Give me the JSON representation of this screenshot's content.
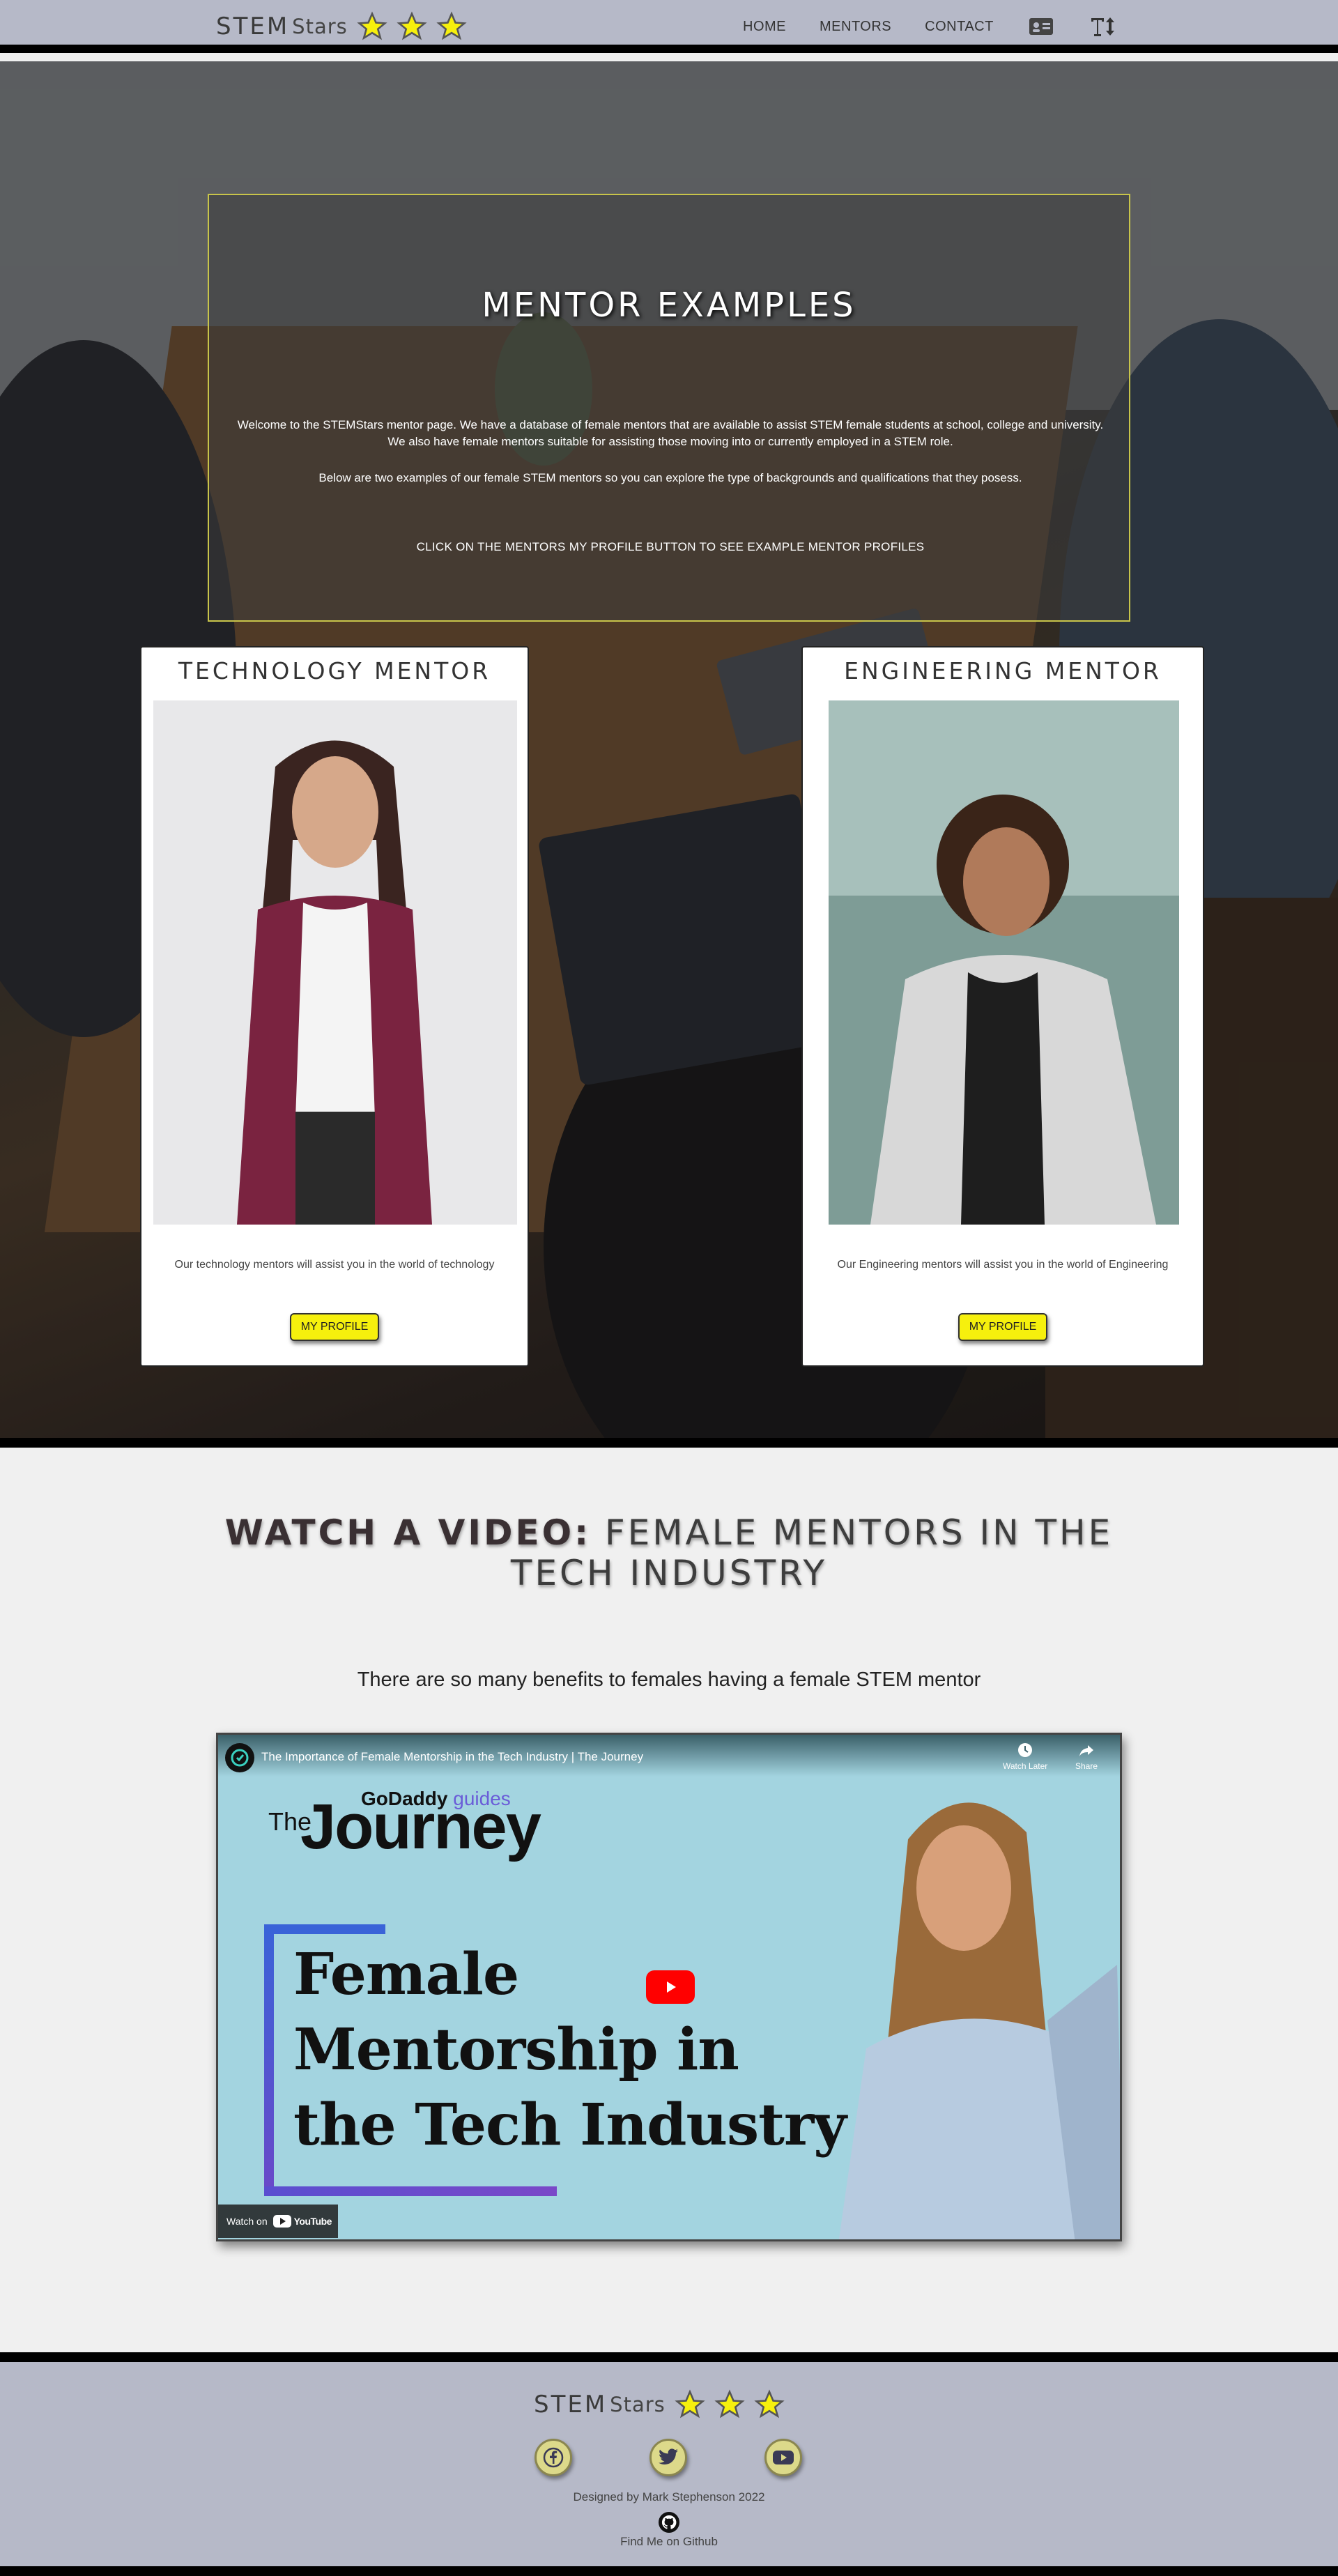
{
  "nav": {
    "brand_stem": "STEM",
    "brand_stars": "Stars",
    "links": [
      "HOME",
      "MENTORS",
      "CONTACT"
    ]
  },
  "intro": {
    "title": "MENTOR EXAMPLES",
    "p1": "Welcome to the STEMStars mentor page. We have a database of female mentors that are available to assist STEM female students at school, college and university. We also have female mentors suitable for assisting those moving into or currently employed in a STEM role.",
    "p2": "Below are two examples of our female STEM mentors so you can explore the type of backgrounds and qualifications that they posess.",
    "cta": "CLICK ON THE MENTORS MY PROFILE BUTTON TO SEE EXAMPLE MENTOR PROFILES"
  },
  "mentors": [
    {
      "title": "TECHNOLOGY MENTOR",
      "desc": "Our technology mentors will assist you in the world of technology",
      "button": "MY PROFILE"
    },
    {
      "title": "ENGINEERING MENTOR",
      "desc": "Our Engineering mentors will assist you in the world of Engineering",
      "button": "MY PROFILE"
    }
  ],
  "video": {
    "heading_bold": "WATCH A VIDEO:",
    "heading_rest": "FEMALE MENTORS IN THE TECH INDUSTRY",
    "subheading": "There are so many benefits to females having a female STEM mentor",
    "title": "The Importance of Female Mentorship in the Tech Industry | The Journey",
    "watch_later": "Watch Later",
    "share": "Share",
    "brand_small": "GoDaddy",
    "brand_guides": "guides",
    "the": "The",
    "journey": "Journey",
    "thumb_line1": "Female",
    "thumb_line2": "Mentorship in",
    "thumb_line3": "the Tech Industry",
    "watch_on": "Watch on",
    "youtube": "YouTube"
  },
  "footer": {
    "brand_stem": "STEM",
    "brand_stars": "Stars",
    "designed": "Designed by Mark Stephenson 2022",
    "find_me": "Find Me on Github"
  },
  "colors": {
    "nav_bg": "#b6b9c8",
    "accent_yellow": "#f6f00d",
    "intro_border": "#c8c44a"
  }
}
